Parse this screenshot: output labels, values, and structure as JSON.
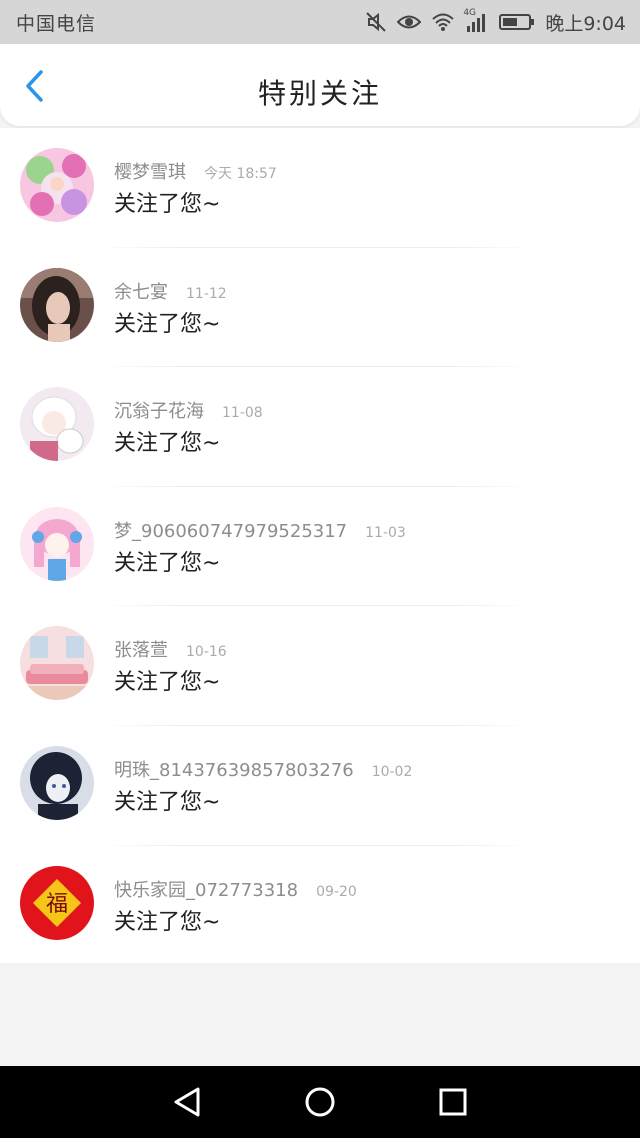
{
  "status_bar": {
    "carrier": "中国电信",
    "network": "4G",
    "time": "晚上9:04"
  },
  "header": {
    "title": "特别关注"
  },
  "items": [
    {
      "name": "樱梦雪琪",
      "time": "今天 18:57",
      "message": "关注了您~",
      "avatar": "pink-flowers-avatar",
      "colors": [
        "#f7c6e0",
        "#9bd48f",
        "#e36fb5"
      ]
    },
    {
      "name": "余七宴",
      "time": "11-12",
      "message": "关注了您~",
      "avatar": "portrait-girl-avatar",
      "colors": [
        "#6b4f4a",
        "#e8c8b8",
        "#2b2220"
      ]
    },
    {
      "name": "沉翁子花海",
      "time": "11-08",
      "message": "关注了您~",
      "avatar": "white-hair-anime-avatar",
      "colors": [
        "#f2eaf0",
        "#ffffff",
        "#d06a8a"
      ]
    },
    {
      "name": "梦_906060747979525317",
      "time": "11-03",
      "message": "关注了您~",
      "avatar": "pink-hair-anime-avatar",
      "colors": [
        "#fde6f2",
        "#f4a8cf",
        "#5fa7e6"
      ]
    },
    {
      "name": "张落萱",
      "time": "10-16",
      "message": "关注了您~",
      "avatar": "pink-room-avatar",
      "colors": [
        "#f6dfe0",
        "#e98b9c",
        "#c8d8e8"
      ]
    },
    {
      "name": "明珠_81437639857803276",
      "time": "10-02",
      "message": "关注了您~",
      "avatar": "dark-hair-anime-avatar",
      "colors": [
        "#1d2235",
        "#d8dde8",
        "#3a5fa0"
      ]
    },
    {
      "name": "快乐家园_072773318",
      "time": "09-20",
      "message": "关注了您~",
      "avatar": "fu-blessing-avatar",
      "colors": [
        "#e2141b",
        "#f5c518",
        "#7a0a0a"
      ]
    }
  ],
  "avatar_text": {
    "fu": "福"
  }
}
